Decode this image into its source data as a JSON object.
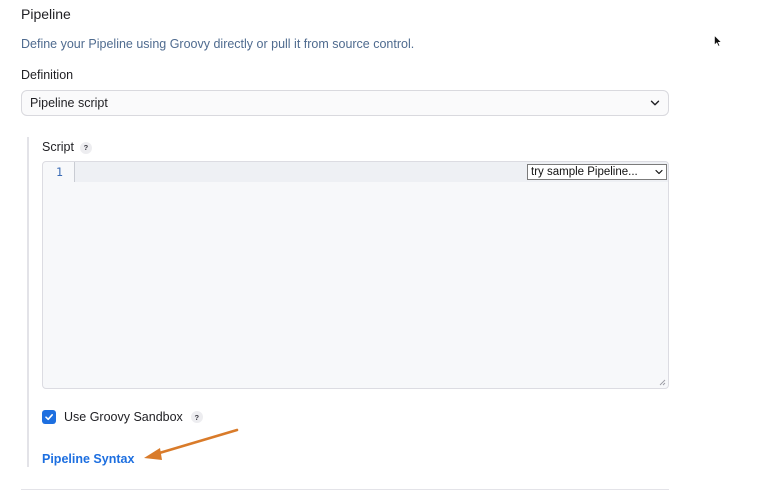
{
  "section": {
    "title": "Pipeline",
    "description": "Define your Pipeline using Groovy directly or pull it from source control."
  },
  "definition": {
    "label": "Definition",
    "selected": "Pipeline script"
  },
  "script": {
    "label": "Script",
    "help": "?",
    "line_number": "1",
    "sample_selected": "try sample Pipeline..."
  },
  "sandbox": {
    "label": "Use Groovy Sandbox",
    "help": "?",
    "checked": true
  },
  "links": {
    "pipeline_syntax": "Pipeline Syntax"
  },
  "colors": {
    "accent": "#1d6fe0",
    "annotation_arrow": "#d97b2a",
    "description_text": "#4f6b8f"
  }
}
